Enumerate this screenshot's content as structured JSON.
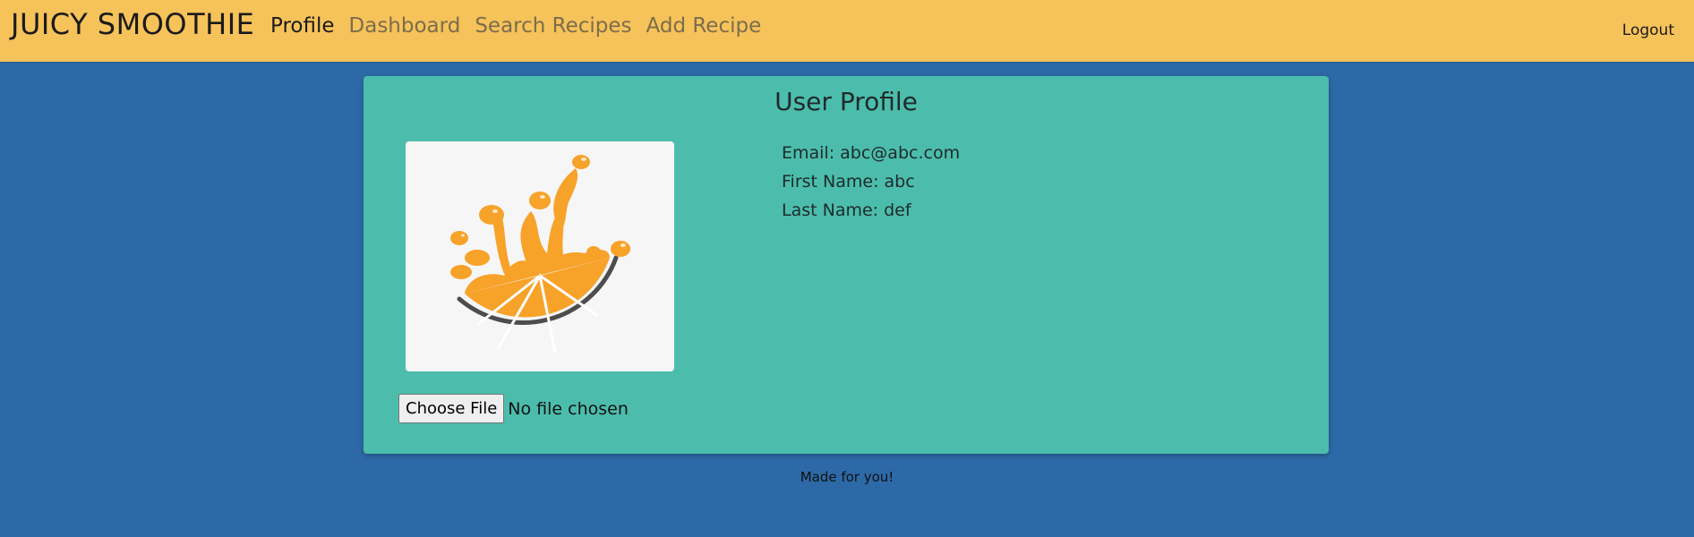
{
  "navbar": {
    "brand": "JUICY SMOOTHIE",
    "links": [
      {
        "label": "Profile",
        "active": true
      },
      {
        "label": "Dashboard",
        "active": false
      },
      {
        "label": "Search Recipes",
        "active": false
      },
      {
        "label": "Add Recipe",
        "active": false
      }
    ],
    "logout_label": "Logout",
    "background_color": "#f6c25a"
  },
  "profile": {
    "title": "User Profile",
    "image_icon": "orange-splash-logo",
    "email_line": "Email: abc@abc.com",
    "first_name_line": "First Name: abc",
    "last_name_line": "Last Name: def",
    "file_input": {
      "button_label": "Choose File",
      "status": "No file chosen"
    },
    "card_color": "#4cbdac"
  },
  "footer": {
    "text": "Made for you!"
  },
  "page_background": "#2d69a7"
}
